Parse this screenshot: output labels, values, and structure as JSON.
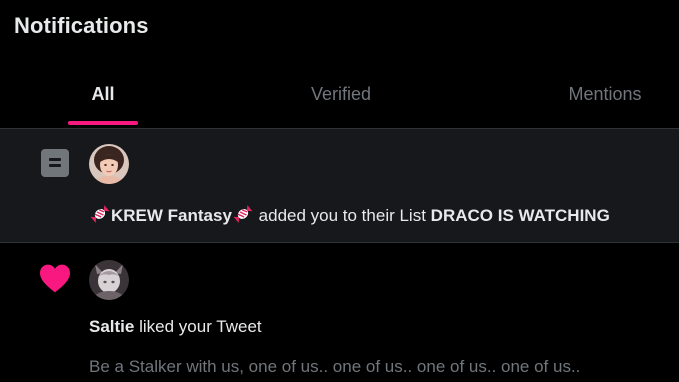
{
  "header": {
    "title": "Notifications"
  },
  "tabs": [
    {
      "label": "All",
      "active": true
    },
    {
      "label": "Verified",
      "active": false
    },
    {
      "label": "Mentions",
      "active": false
    }
  ],
  "colors": {
    "accent": "#f91880",
    "background": "#000000",
    "row_highlight": "#16181c",
    "text_primary": "#e7e9ea",
    "text_secondary": "#71767b",
    "divider": "#2f3336"
  },
  "notifications": [
    {
      "type_icon": "list-icon",
      "avatar": "user-avatar",
      "decor_emoji": "candy-emoji",
      "actor": "KREW Fantasy",
      "action_text": "added you to their List",
      "target": "DRACO IS WATCHING"
    },
    {
      "type_icon": "heart-icon",
      "avatar": "user-avatar",
      "actor": "Saltie",
      "action_text": "liked your Tweet",
      "tweet_text": "Be a Stalker with us, one of us.. one of us.. one of us.. one of us.."
    }
  ]
}
